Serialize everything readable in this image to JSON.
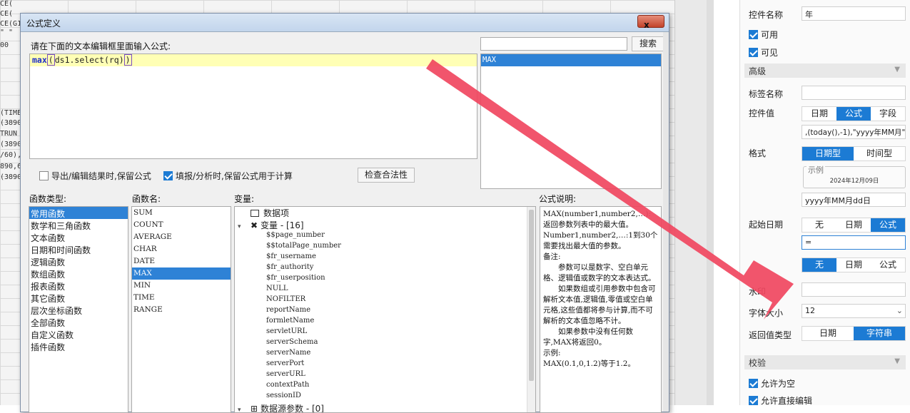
{
  "background": {
    "lines_top": [
      "CE(",
      "CE(",
      "CE(G1",
      "\"   \"",
      "00"
    ],
    "lines_mid": [
      "(TIME",
      "(3890",
      "TRUN",
      "(3890",
      "/60),",
      "890,6",
      "(3890"
    ]
  },
  "panel": {
    "control_name_label": "控件名称",
    "control_name_value": "年",
    "enabled_label": "可用",
    "visible_label": "可见",
    "advanced_section": "高级",
    "tag_name_label": "标签名称",
    "tag_name_value": "",
    "control_value_label": "控件值",
    "control_value_tabs": [
      "日期",
      "公式",
      "字段"
    ],
    "control_value_formula": ",(today(),-1),\"yyyy年MM月\")",
    "format_label": "格式",
    "format_tabs": [
      "日期型",
      "时间型"
    ],
    "example_label": "示例",
    "example_value": "2024年12月09日",
    "format_value": "yyyy年MM月dd日",
    "start_date_label": "起始日期",
    "start_date_tabs": [
      "无",
      "日期",
      "公式"
    ],
    "start_date_value": "=",
    "end_date_tabs": [
      "无",
      "日期",
      "公式"
    ],
    "watermark_label": "水印",
    "watermark_value": "",
    "font_size_label": "字体大小",
    "font_size_value": "12",
    "return_type_label": "返回值类型",
    "return_type_tabs": [
      "日期",
      "字符串"
    ],
    "validate_section": "校验",
    "allow_empty_label": "允许为空",
    "allow_edit_label": "允许直接编辑"
  },
  "dialog": {
    "title": "公式定义",
    "close_label": "x",
    "editor_prompt": "请在下面的文本编辑框里面输入公式:",
    "formula": {
      "fn": "max",
      "open": "(",
      "body": "ds1.select(rq)",
      "close": ")"
    },
    "search_placeholder": "",
    "search_button": "搜索",
    "search_result": "MAX",
    "keep_formula_export": "导出/编辑结果时,保留公式",
    "keep_formula_fill": "填报/分析时,保留公式用于计算",
    "check_validity_button": "检查合法性",
    "func_type_label": "函数类型:",
    "func_name_label": "函数名:",
    "variable_label": "变量:",
    "formula_desc_label": "公式说明:",
    "func_types": [
      "常用函数",
      "数学和三角函数",
      "文本函数",
      "日期和时间函数",
      "逻辑函数",
      "数组函数",
      "报表函数",
      "其它函数",
      "层次坐标函数",
      "全部函数",
      "自定义函数",
      "插件函数"
    ],
    "func_names": [
      "SUM",
      "COUNT",
      "AVERAGE",
      "CHAR",
      "DATE",
      "MAX",
      "MIN",
      "TIME",
      "RANGE"
    ],
    "variables": {
      "data_item": "数据项",
      "var_group": "变量 - [16]",
      "items": [
        "$$page_number",
        "$$totalPage_number",
        "$fr_username",
        "$fr_authority",
        "$fr_userposition",
        "NULL",
        "NOFILTER",
        "reportName",
        "formletName",
        "servletURL",
        "serverSchema",
        "serverName",
        "serverPort",
        "serverURL",
        "contextPath",
        "sessionID"
      ],
      "datasource_group": "数据源参数 - [0]"
    },
    "description": [
      "MAX(number1,number2,…): 返回参数列表中的最大值。",
      "Number1,number2,…:1到30个需要找出最大值的参数。",
      "备注:",
      "　　参数可以是数字、空白单元格、逻辑值或数字的文本表达式。",
      "　　如果数组或引用参数中包含可解析文本值,逻辑值,零值或空白单元格,这些值都将参与计算,而不可解析的文本值忽略不计。",
      "　　如果参数中没有任何数字,MAX将返回0。",
      "示例:",
      "MAX(0.1,0,1.2)等于1.2。"
    ]
  },
  "colors": {
    "accent": "#1c7bd4",
    "arrow": "#f0475f",
    "selection": "#2e82d6"
  }
}
